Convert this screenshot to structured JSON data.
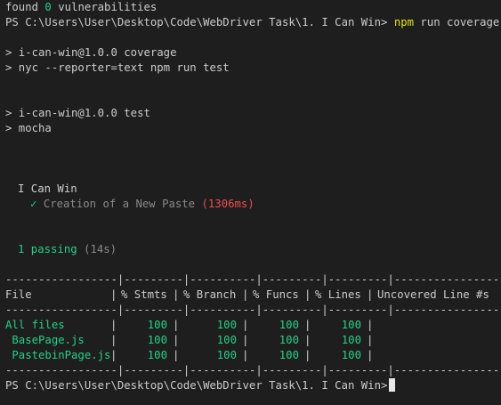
{
  "terminal": {
    "found_prefix": "found ",
    "found_zero": "0",
    "found_suffix": " vulnerabilities",
    "prompt": "PS C:\\Users\\User\\Desktop\\Code\\WebDriver Task\\1. I Can Win>",
    "command_bin": "npm",
    "command_args": " run coverage",
    "coverage_script": "> i-can-win@1.0.0 coverage",
    "coverage_cmd": "> nyc --reporter=text npm run test",
    "test_script": "> i-can-win@1.0.0 test",
    "test_cmd": "> mocha",
    "suite_name": "I Can Win",
    "check_mark": "✓",
    "test_title": "Creation of a New Paste",
    "test_time": "(1306ms)",
    "passing_label": "1 passing",
    "passing_time": "(14s)"
  },
  "coverage": {
    "divider": "-----------------|---------|----------|---------|---------|-------------------",
    "headers": [
      "File",
      "% Stmts",
      "% Branch",
      "% Funcs",
      "% Lines",
      "Uncovered Line #s"
    ],
    "rows": [
      {
        "file": "All files",
        "stmts": "100",
        "branch": "100",
        "funcs": "100",
        "lines": "100",
        "uncovered": ""
      },
      {
        "file": " BasePage.js",
        "stmts": "100",
        "branch": "100",
        "funcs": "100",
        "lines": "100",
        "uncovered": ""
      },
      {
        "file": " PastebinPage.js",
        "stmts": "100",
        "branch": "100",
        "funcs": "100",
        "lines": "100",
        "uncovered": ""
      }
    ]
  },
  "colors": {
    "background": "#1e1e1e",
    "text": "#cccccc",
    "highlight": "#e5e510",
    "success": "#23d18b",
    "error": "#f14c4c"
  }
}
